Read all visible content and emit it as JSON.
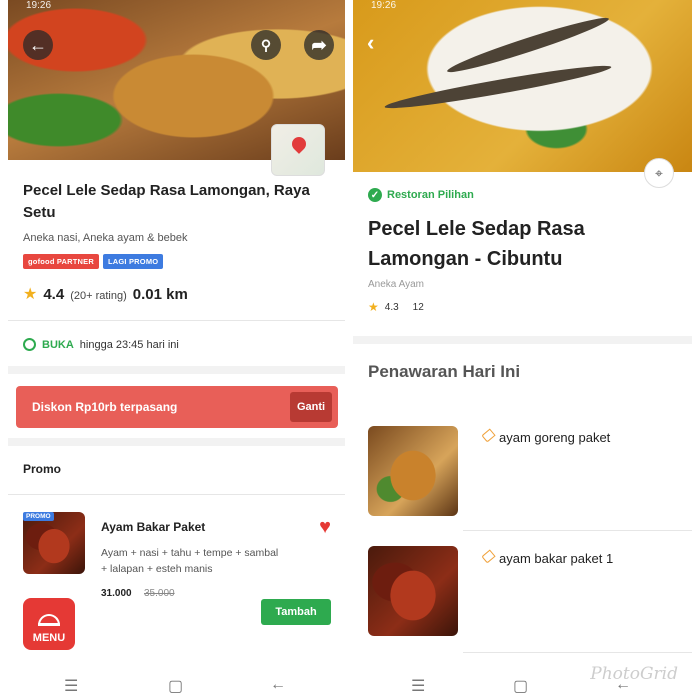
{
  "left": {
    "status_time": "19:26",
    "title": "Pecel Lele Sedap Rasa Lamongan, Raya Setu",
    "cuisine": "Aneka nasi, Aneka ayam & bebek",
    "badges": [
      "gofood PARTNER",
      "LAGI PROMO"
    ],
    "rating": "4.4",
    "rating_count": "(20+ rating)",
    "distance": "0.01 km",
    "open_status": "BUKA",
    "open_hours": "hingga 23:45 hari ini",
    "discount_text": "Diskon Rp10rb terpasang",
    "discount_button": "Ganti",
    "section_title": "Promo",
    "item": {
      "promo_tag": "PROMO",
      "name": "Ayam Bakar Paket",
      "description": "Ayam + nasi + tahu + tempe + sambal + lalapan + esteh manis",
      "price": "31.000",
      "old_price": "35.000",
      "add_button": "Tambah"
    },
    "menu_button": "MENU"
  },
  "right": {
    "status_time": "19:26",
    "chosen_label": "Restoran Pilihan",
    "title": "Pecel Lele Sedap Rasa Lamongan - Cibuntu",
    "cuisine": "Aneka Ayam",
    "rating": "4.3",
    "rating_count": "12",
    "section_title": "Penawaran Hari Ini",
    "items": [
      {
        "name": "ayam goreng paket"
      },
      {
        "name": "ayam bakar paket 1"
      }
    ]
  },
  "watermark": "PhotoGrid",
  "colors": {
    "green": "#2eaa4f",
    "red": "#e53935",
    "promo": "#e85f58"
  }
}
